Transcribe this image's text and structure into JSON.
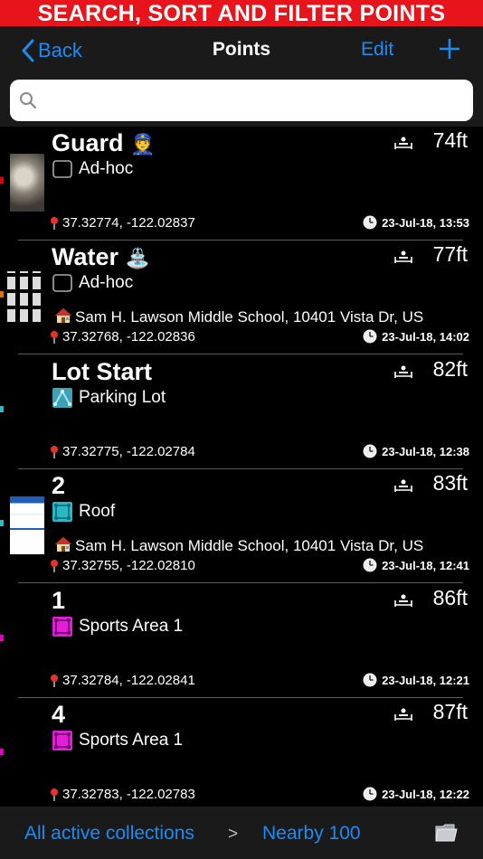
{
  "banner": "SEARCH, SORT AND FILTER POINTS",
  "nav": {
    "back": "Back",
    "title": "Points",
    "edit": "Edit",
    "add_icon": "plus-icon"
  },
  "search": {
    "value": "",
    "placeholder": ""
  },
  "colors": {
    "accent": "#1c8cf5",
    "banner": "#e8141b",
    "bar": "#1a1a1a"
  },
  "points": [
    {
      "title": "Guard",
      "emoji": "👮",
      "distance": "74ft",
      "collection": "Ad-hoc",
      "collection_icon": "folder-outline-icon",
      "address": "",
      "coords": "37.32774, -122.02837",
      "time": "23-Jul-18, 13:53",
      "tag_color": "#e00000",
      "thumb": "cat-photo"
    },
    {
      "title": "Water",
      "emoji": "⛲",
      "distance": "77ft",
      "collection": "Ad-hoc",
      "collection_icon": "folder-outline-icon",
      "address": "Sam H. Lawson Middle School, 10401 Vista Dr, US",
      "coords": "37.32768, -122.02836",
      "time": "23-Jul-18, 14:02",
      "tag_color": "#e07000",
      "thumb": "screenshot-grid"
    },
    {
      "title": "Lot Start",
      "emoji": "",
      "distance": "82ft",
      "collection": "Parking Lot",
      "collection_icon": "polyline-teal-icon",
      "address": "",
      "coords": "37.32775, -122.02784",
      "time": "23-Jul-18, 12:38",
      "tag_color": "#20c0c8",
      "thumb": ""
    },
    {
      "title": "2",
      "emoji": "",
      "distance": "83ft",
      "collection": "Roof",
      "collection_icon": "polygon-cyan-icon",
      "address": "Sam H. Lawson Middle School, 10401 Vista Dr, US",
      "coords": "37.32755, -122.02810",
      "time": "23-Jul-18, 12:41",
      "tag_color": "#20c0c8",
      "thumb": "webpage-screenshot"
    },
    {
      "title": "1",
      "emoji": "",
      "distance": "86ft",
      "collection": "Sports Area 1",
      "collection_icon": "polygon-magenta-icon",
      "address": "",
      "coords": "37.32784, -122.02841",
      "time": "23-Jul-18, 12:21",
      "tag_color": "#e000c0",
      "thumb": ""
    },
    {
      "title": "4",
      "emoji": "",
      "distance": "87ft",
      "collection": "Sports Area 1",
      "collection_icon": "polygon-magenta-icon",
      "address": "",
      "coords": "37.32783, -122.02783",
      "time": "23-Jul-18, 12:22",
      "tag_color": "#e000c0",
      "thumb": ""
    }
  ],
  "footer": {
    "collections": "All active collections",
    "separator": ">",
    "nearby": "Nearby 100",
    "folder_icon": "folder-icon"
  }
}
